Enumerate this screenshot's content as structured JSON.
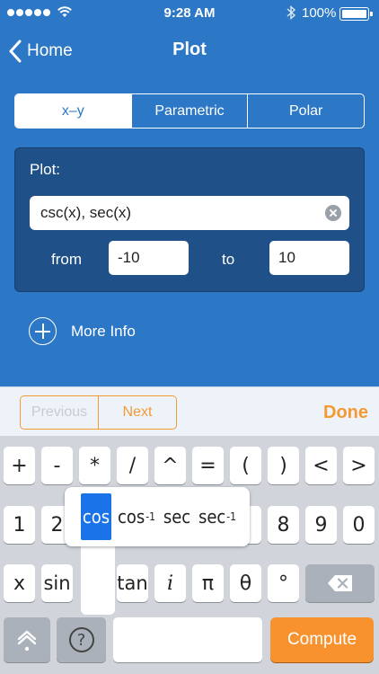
{
  "status_bar": {
    "time": "9:28 AM",
    "battery": "100%"
  },
  "nav": {
    "back": "Home",
    "title": "Plot"
  },
  "segments": [
    "x–y",
    "Parametric",
    "Polar"
  ],
  "selected_segment": 0,
  "plot": {
    "label": "Plot:",
    "expression": "csc(x), sec(x)",
    "from_label": "from",
    "from_value": "-10",
    "to_label": "to",
    "to_value": "10"
  },
  "more_info": "More Info",
  "toolbar": {
    "previous": "Previous",
    "next": "Next",
    "done": "Done"
  },
  "keyboard": {
    "row1": [
      "+",
      "-",
      "*",
      "/",
      "^",
      "=",
      "(",
      ")",
      "<",
      ">"
    ],
    "row2": [
      "1",
      "2",
      "",
      "",
      "",
      "",
      "",
      "8",
      "9",
      "0"
    ],
    "row3": [
      "x",
      "sin",
      "",
      "tan",
      "i",
      "π",
      "θ",
      "°"
    ],
    "popup": [
      {
        "base": "cos",
        "sup": ""
      },
      {
        "base": "cos",
        "sup": "-1"
      },
      {
        "base": "sec",
        "sup": ""
      },
      {
        "base": "sec",
        "sup": "-1"
      }
    ],
    "help": "?",
    "compute": "Compute"
  },
  "colors": {
    "accent": "#f39a35",
    "header": "#2c78c6",
    "panel": "#1f5088",
    "selected_key": "#1a73e8"
  }
}
